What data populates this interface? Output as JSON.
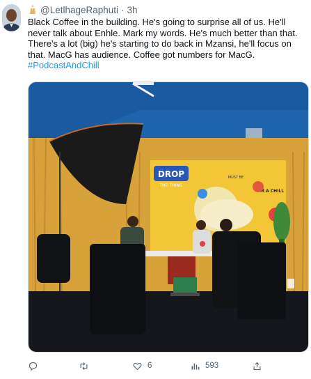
{
  "tweet": {
    "handle": "@LetlhageRaphuti",
    "separator": "·",
    "time": "3h",
    "text": "Black Coffee in the building. He's going to surprise all of us. He'll never talk about Enhle. Mark my words. He's much better than that. There's a lot (big) he's starting to do back in Mzansi, he'll focus on that. MacG has audience. Coffee got numbers for MacG.",
    "hashtag": "#PodcastAndChill"
  },
  "media": {
    "backdrop_title": "DROP",
    "backdrop_subtitle": "THE THING",
    "sticker_1": "I'M A CHILL",
    "sticker_2": "MUST BE"
  },
  "actions": {
    "reply": "",
    "retweet": "",
    "like": "6",
    "views": "593",
    "share": ""
  },
  "icons": {
    "reply": "reply-icon",
    "retweet": "retweet-icon",
    "like": "heart-icon",
    "views": "views-icon",
    "share": "share-icon",
    "emoji": "hands-emoji-icon"
  },
  "colors": {
    "text": "#0f1419",
    "secondary": "#536471",
    "link": "#1d9bf0"
  }
}
